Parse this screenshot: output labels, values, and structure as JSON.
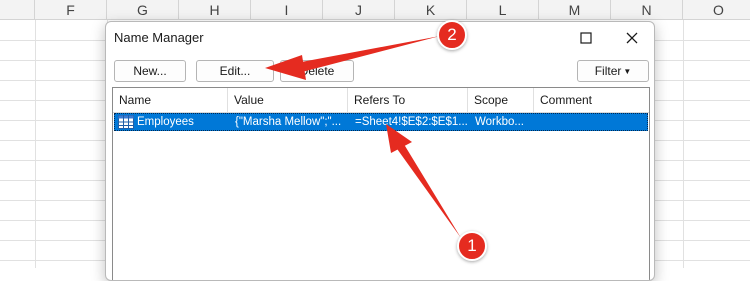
{
  "spreadsheet": {
    "columns": [
      "F",
      "G",
      "H",
      "I",
      "J",
      "K",
      "L",
      "M",
      "N",
      "O"
    ]
  },
  "dialog": {
    "title": "Name Manager",
    "buttons": {
      "new_label": "New...",
      "edit_label": "Edit...",
      "delete_label": "Delete",
      "filter_label": "Filter"
    },
    "columns": [
      "Name",
      "Value",
      "Refers To",
      "Scope",
      "Comment"
    ],
    "rows": [
      {
        "name": "Employees",
        "value": "{\"Marsha Mellow\";\"...",
        "refers_to": "=Sheet4!$E$2:$E$1...",
        "scope": "Workbo...",
        "comment": ""
      }
    ]
  },
  "annotations": {
    "badge_1": "1",
    "badge_2": "2",
    "color": "#e52b20"
  },
  "colors": {
    "selection": "#0078d7",
    "annotation_red": "#e52b20"
  }
}
